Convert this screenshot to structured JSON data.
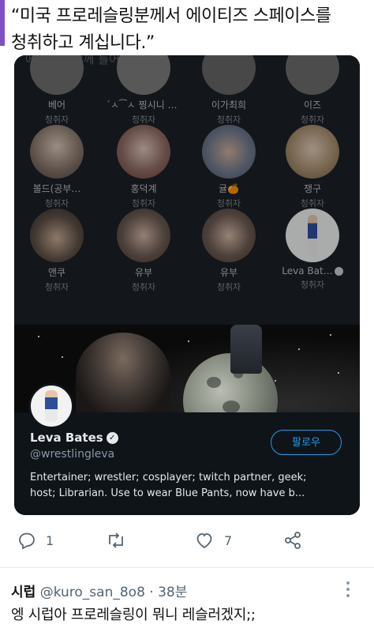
{
  "tweet": {
    "text_line1": "“미국 프로레슬링분께서 에이티즈 스페이스를",
    "text_line2": "청취하고 계십니다.”"
  },
  "space": {
    "header_title": "에이티니 함께 들어요",
    "participants": [
      {
        "name": "베어",
        "role": "청취자"
      },
      {
        "name": "´ㅅ⁀ㅅ 찡시니 ㅅ⁀ㅅ",
        "role": "청취자"
      },
      {
        "name": "이가최희",
        "role": "청취자"
      },
      {
        "name": "이즈",
        "role": "청취자"
      },
      {
        "name": "볼드(공부…",
        "role": "청취자"
      },
      {
        "name": "홍덕계",
        "role": "청취자"
      },
      {
        "name": "귤🍊",
        "role": "청취자"
      },
      {
        "name": "쟁구",
        "role": "청취자"
      },
      {
        "name": "앤쿠",
        "role": "청취자"
      },
      {
        "name": "유부",
        "role": "청취자"
      },
      {
        "name": "유부",
        "role": "청취자"
      },
      {
        "name": "Leva Bat…",
        "role": "청취자"
      }
    ]
  },
  "profile_card": {
    "name": "Leva Bates",
    "handle": "@wrestlingleva",
    "follow_label": "팔로우",
    "bio_line1": "Entertainer; wrestler; cosplayer; twitch partner, geek;",
    "bio_line2": "host; Librarian. Use to wear Blue Pants, now have b..."
  },
  "actions": {
    "reply_count": "1",
    "retweet_count": "",
    "like_count": "7"
  },
  "reply": {
    "author": "시럽",
    "handle": "@kuro_san_8o8",
    "time": "· 38분",
    "text": "엥 시럽아 프로레슬링이 뭐니 레슬러겠지;;"
  },
  "colors": {
    "accent": "#1d9bf0",
    "card_bg": "#0f1419",
    "muted": "#536471"
  }
}
